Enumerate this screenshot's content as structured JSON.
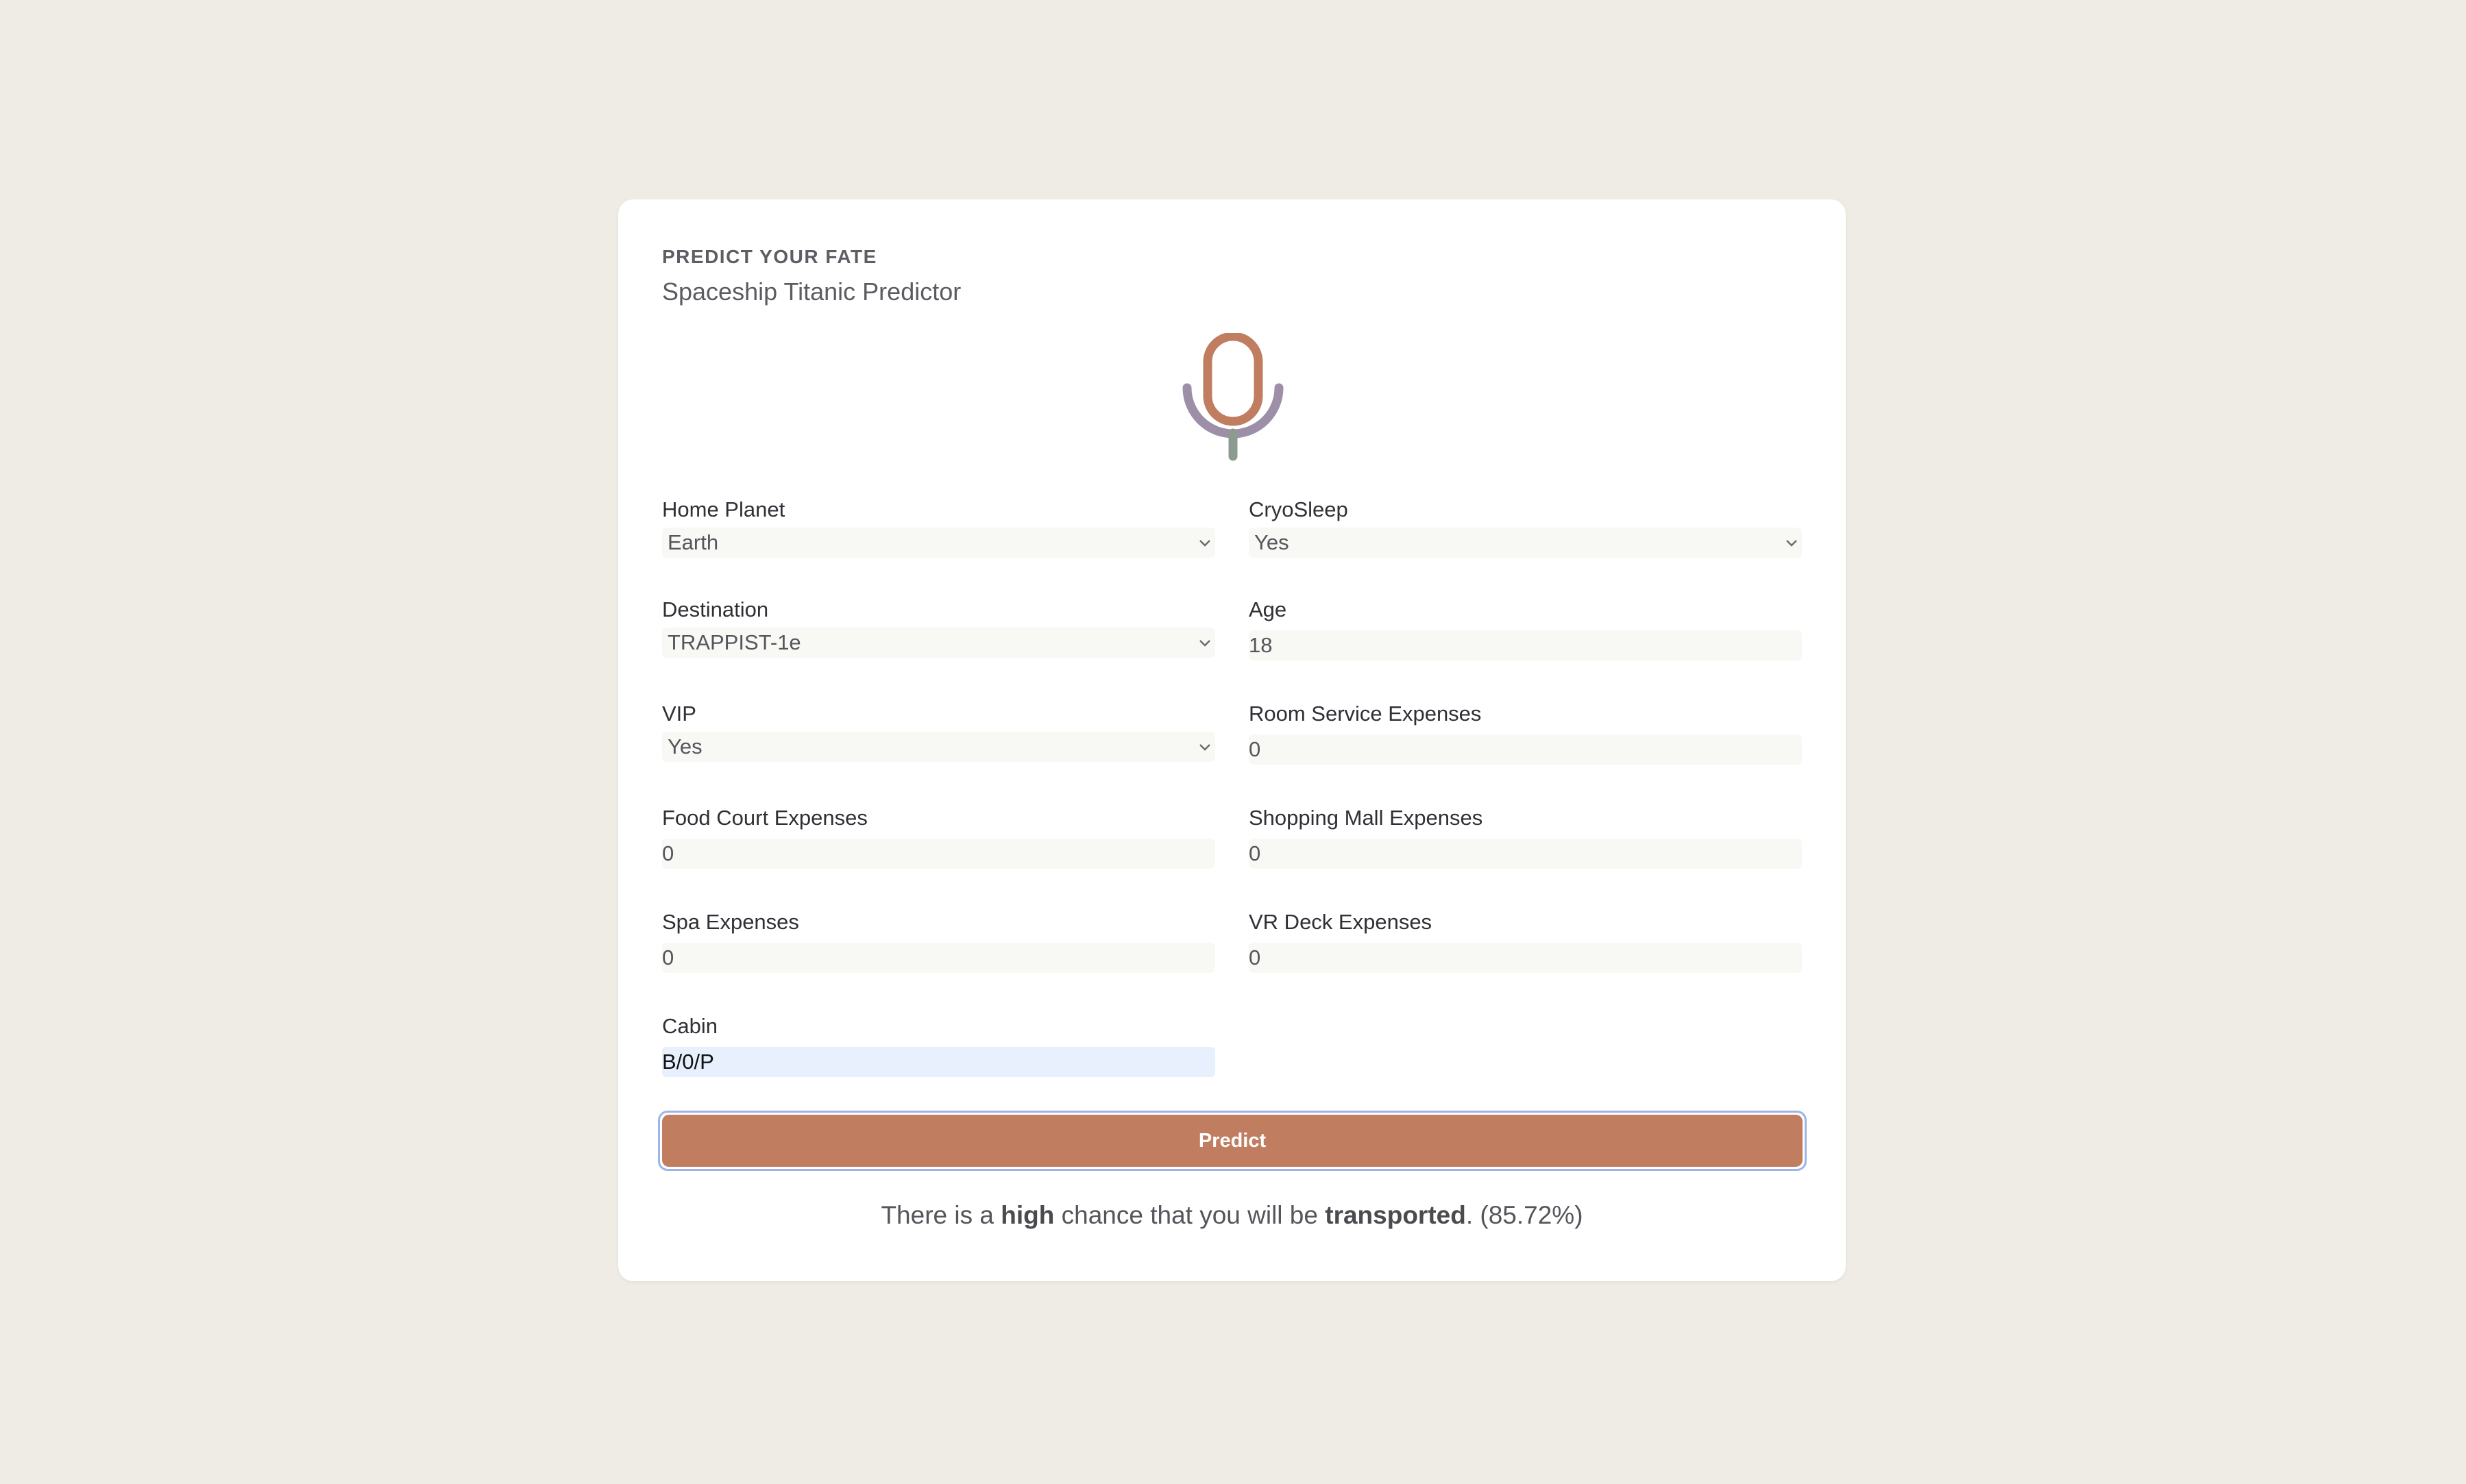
{
  "header": {
    "eyebrow": "PREDICT YOUR FATE",
    "title": "Spaceship Titanic Predictor"
  },
  "logo": {
    "icon": "microphone-icon",
    "colors": {
      "capsule": "#c07d60",
      "cradle": "#9e8fa8",
      "stand": "#8c9a90"
    }
  },
  "form": {
    "home_planet": {
      "label": "Home Planet",
      "value": "Earth"
    },
    "cryosleep": {
      "label": "CryoSleep",
      "value": "Yes"
    },
    "destination": {
      "label": "Destination",
      "value": "TRAPPIST-1e"
    },
    "age": {
      "label": "Age",
      "value": "18"
    },
    "vip": {
      "label": "VIP",
      "value": "Yes"
    },
    "room_service": {
      "label": "Room Service Expenses",
      "value": "0"
    },
    "food_court": {
      "label": "Food Court Expenses",
      "value": "0"
    },
    "shopping_mall": {
      "label": "Shopping Mall Expenses",
      "value": "0"
    },
    "spa": {
      "label": "Spa Expenses",
      "value": "0"
    },
    "vr_deck": {
      "label": "VR Deck Expenses",
      "value": "0"
    },
    "cabin": {
      "label": "Cabin",
      "value": "B/0/P"
    }
  },
  "predict_button": {
    "label": "Predict",
    "color": "#c07d60"
  },
  "result": {
    "prefix": "There is a ",
    "level": "high",
    "middle": " chance that you will be ",
    "outcome": "transported",
    "suffix": ". (85.72%)"
  },
  "colors": {
    "page_background": "#efece5",
    "card_background": "#ffffff",
    "focus_ring": "#9db4e8",
    "active_input": "#e8f0fe"
  }
}
